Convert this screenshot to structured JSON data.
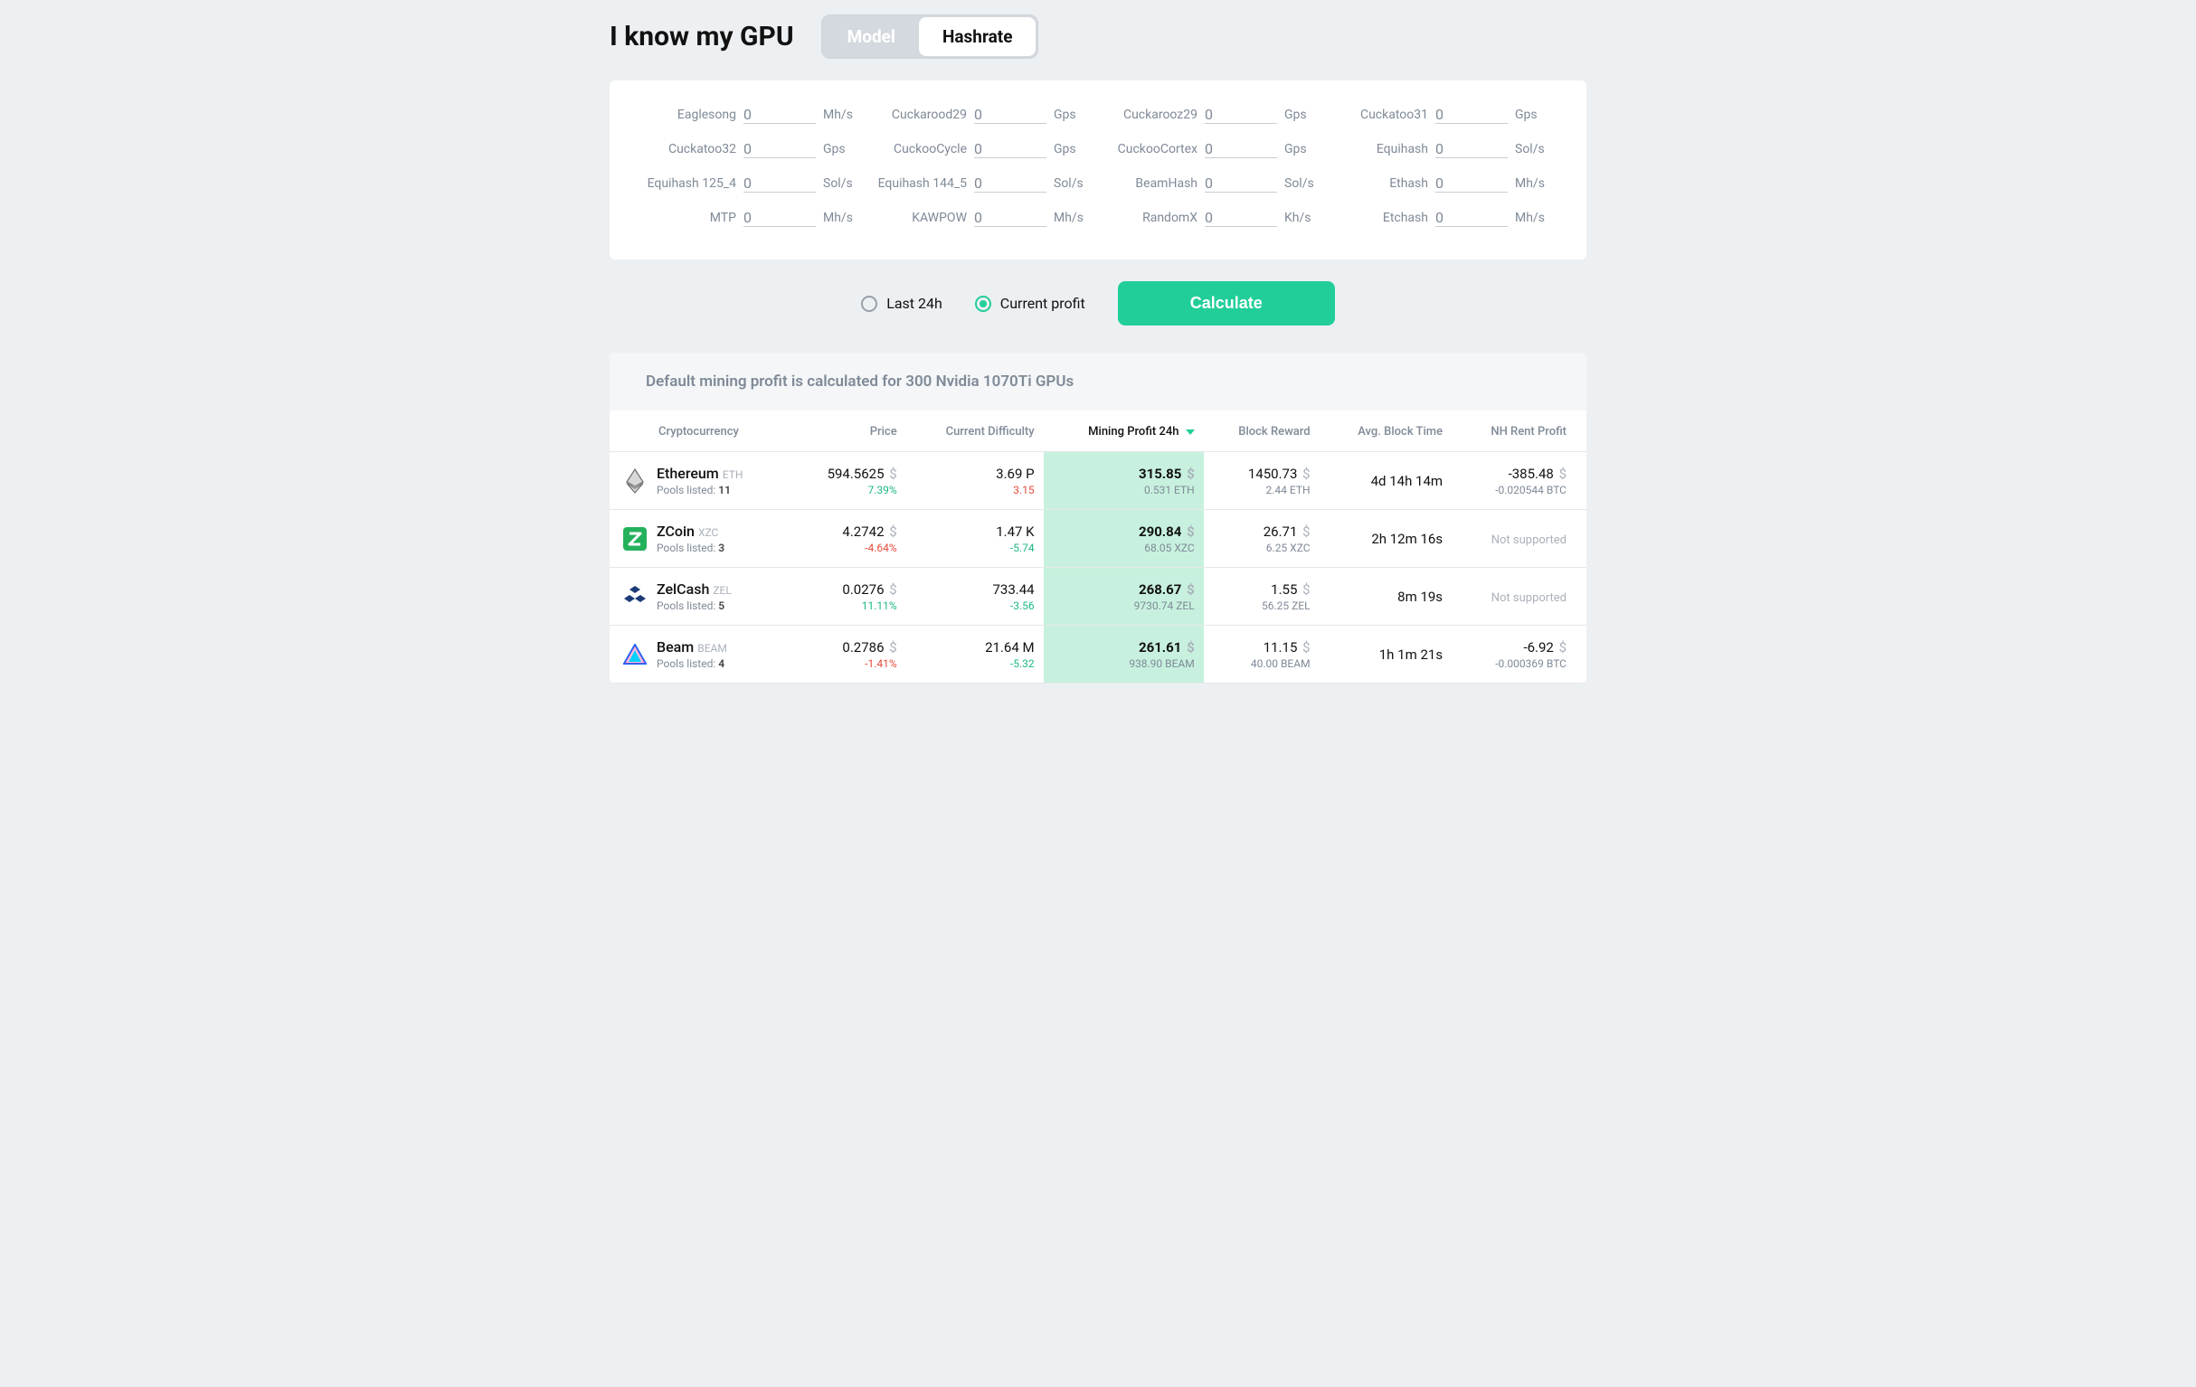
{
  "page": {
    "title": "I know my GPU",
    "toggle": {
      "model": "Model",
      "hashrate": "Hashrate",
      "active": "hashrate"
    }
  },
  "hashrates": [
    {
      "label": "Eaglesong",
      "value": "0",
      "unit": "Mh/s"
    },
    {
      "label": "Cuckarood29",
      "value": "0",
      "unit": "Gps"
    },
    {
      "label": "Cuckarooz29",
      "value": "0",
      "unit": "Gps"
    },
    {
      "label": "Cuckatoo31",
      "value": "0",
      "unit": "Gps"
    },
    {
      "label": "Cuckatoo32",
      "value": "0",
      "unit": "Gps"
    },
    {
      "label": "CuckooCycle",
      "value": "0",
      "unit": "Gps"
    },
    {
      "label": "CuckooCortex",
      "value": "0",
      "unit": "Gps"
    },
    {
      "label": "Equihash",
      "value": "0",
      "unit": "Sol/s"
    },
    {
      "label": "Equihash 125_4",
      "value": "0",
      "unit": "Sol/s"
    },
    {
      "label": "Equihash 144_5",
      "value": "0",
      "unit": "Sol/s"
    },
    {
      "label": "BeamHash",
      "value": "0",
      "unit": "Sol/s"
    },
    {
      "label": "Ethash",
      "value": "0",
      "unit": "Mh/s"
    },
    {
      "label": "MTP",
      "value": "0",
      "unit": "Mh/s"
    },
    {
      "label": "KAWPOW",
      "value": "0",
      "unit": "Mh/s"
    },
    {
      "label": "RandomX",
      "value": "0",
      "unit": "Kh/s"
    },
    {
      "label": "Etchash",
      "value": "0",
      "unit": "Mh/s"
    }
  ],
  "options": {
    "last24h": "Last 24h",
    "current": "Current profit",
    "selected": "current",
    "calculate": "Calculate"
  },
  "notice": "Default mining profit is calculated for 300 Nvidia 1070Ti GPUs",
  "columns": {
    "crypto": "Cryptocurrency",
    "price": "Price",
    "difficulty": "Current Difficulty",
    "profit": "Mining Profit 24h",
    "reward": "Block Reward",
    "blocktime": "Avg. Block Time",
    "nhrent": "NH Rent Profit",
    "pools_label": "Pools listed:"
  },
  "rows": [
    {
      "name": "Ethereum",
      "ticker": "ETH",
      "pools": "11",
      "price": "594.5625",
      "price_change": "7.39%",
      "price_dir": "up",
      "difficulty": "3.69 P",
      "diff_change": "3.15",
      "diff_dir": "up_red",
      "profit": "315.85",
      "profit_sub": "0.531 ETH",
      "reward": "1450.73",
      "reward_sub": "2.44 ETH",
      "blocktime": "4d 14h 14m",
      "nh_main": "-385.48",
      "nh_sub": "-0.020544 BTC",
      "nh_supported": true
    },
    {
      "name": "ZCoin",
      "ticker": "XZC",
      "pools": "3",
      "price": "4.2742",
      "price_change": "-4.64%",
      "price_dir": "down",
      "difficulty": "1.47 K",
      "diff_change": "-5.74",
      "diff_dir": "down_green",
      "profit": "290.84",
      "profit_sub": "68.05 XZC",
      "reward": "26.71",
      "reward_sub": "6.25 XZC",
      "blocktime": "2h 12m 16s",
      "nh_supported": false,
      "nh_text": "Not supported"
    },
    {
      "name": "ZelCash",
      "ticker": "ZEL",
      "pools": "5",
      "price": "0.0276",
      "price_change": "11.11%",
      "price_dir": "up",
      "difficulty": "733.44",
      "diff_change": "-3.56",
      "diff_dir": "down_green",
      "profit": "268.67",
      "profit_sub": "9730.74 ZEL",
      "reward": "1.55",
      "reward_sub": "56.25 ZEL",
      "blocktime": "8m 19s",
      "nh_supported": false,
      "nh_text": "Not supported"
    },
    {
      "name": "Beam",
      "ticker": "BEAM",
      "pools": "4",
      "price": "0.2786",
      "price_change": "-1.41%",
      "price_dir": "down",
      "difficulty": "21.64 M",
      "diff_change": "-5.32",
      "diff_dir": "down_green",
      "profit": "261.61",
      "profit_sub": "938.90 BEAM",
      "reward": "11.15",
      "reward_sub": "40.00 BEAM",
      "blocktime": "1h 1m 21s",
      "nh_main": "-6.92",
      "nh_sub": "-0.000369 BTC",
      "nh_supported": true
    }
  ]
}
